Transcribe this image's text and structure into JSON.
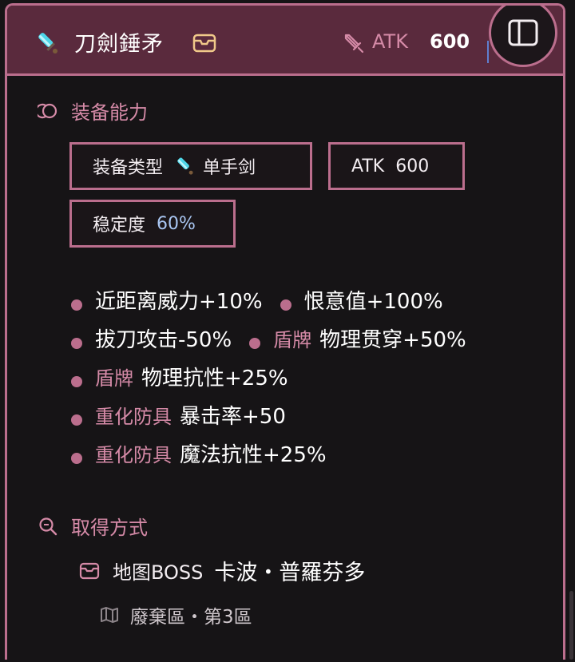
{
  "header": {
    "title": "刀劍錘矛",
    "atk_label": "ATK",
    "atk_value": "600",
    "item_icon": "sword-icon",
    "box_icon": "box-icon",
    "atk_icon": "sword-outline-icon",
    "toggle_icon": "sidebar-panel-icon"
  },
  "ability": {
    "heading": "装备能力",
    "icon": "swirl-icon",
    "chips": {
      "type_label": "装备类型",
      "type_value": "单手剑",
      "atk_label": "ATK",
      "atk_value": "600",
      "stability_label": "稳定度",
      "stability_value": "60%"
    },
    "effects": [
      [
        {
          "tag": "",
          "text": "近距离威力+10%"
        },
        {
          "tag": "",
          "text": "恨意值+100%"
        }
      ],
      [
        {
          "tag": "",
          "text": "拔刀攻击-50%"
        },
        {
          "tag": "盾牌",
          "text": "物理贯穿+50%"
        }
      ],
      [
        {
          "tag": "盾牌",
          "text": "物理抗性+25%"
        }
      ],
      [
        {
          "tag": "重化防具",
          "text": "暴击率+50"
        }
      ],
      [
        {
          "tag": "重化防具",
          "text": "魔法抗性+25%"
        }
      ]
    ]
  },
  "obtain": {
    "heading": "取得方式",
    "icon": "search-icon",
    "source_type": "地图BOSS",
    "source_name": "卡波・普羅芬多",
    "location": "廢棄區・第3區",
    "source_icon": "box-icon",
    "location_icon": "map-icon"
  },
  "colors": {
    "accent": "#bb6e8d",
    "header_bg": "#5a2a3d",
    "background": "#161416",
    "stability_value": "#a9c6f2"
  }
}
